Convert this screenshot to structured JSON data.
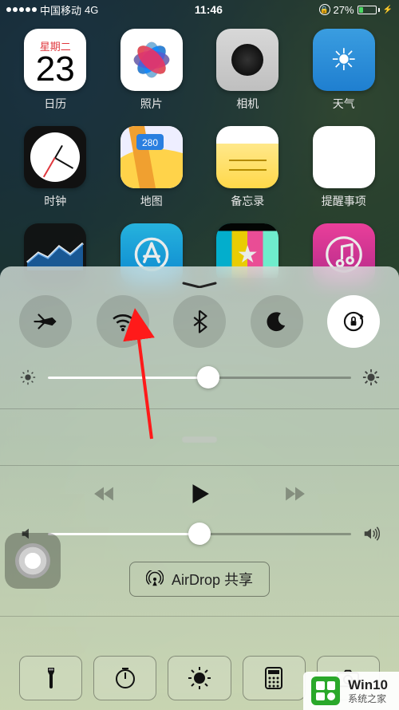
{
  "status": {
    "carrier": "中国移动",
    "network": "4G",
    "time": "11:46",
    "battery_pct": "27%"
  },
  "apps": {
    "row1": [
      {
        "label": "日历",
        "weekday": "星期二",
        "day": "23"
      },
      {
        "label": "照片"
      },
      {
        "label": "相机"
      },
      {
        "label": "天气"
      }
    ],
    "row2": [
      {
        "label": "时钟"
      },
      {
        "label": "地图",
        "badge": "280"
      },
      {
        "label": "备忘录"
      },
      {
        "label": "提醒事项"
      }
    ]
  },
  "control_center": {
    "toggles": {
      "airplane": {
        "active": false
      },
      "wifi": {
        "active": false
      },
      "bluetooth": {
        "active": false
      },
      "dnd": {
        "active": false
      },
      "orientation_lock": {
        "active": true
      }
    },
    "brightness": {
      "value_pct": 53
    },
    "now_playing": {
      "title": ""
    },
    "volume": {
      "value_pct": 50
    },
    "airdrop_label": "AirDrop 共享"
  },
  "watermark": {
    "line1": "Win10",
    "line2": "系统之家"
  }
}
